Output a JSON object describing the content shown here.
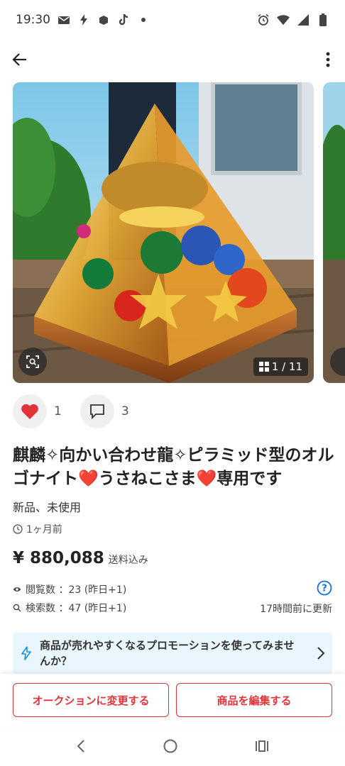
{
  "status_bar": {
    "time": "19:30",
    "left_icons": [
      "mail-icon",
      "bolt-icon",
      "app-icon",
      "tiktok-icon",
      "dot-icon"
    ],
    "right_icons": [
      "alarm-icon",
      "wifi-icon",
      "signal-icon",
      "battery-icon"
    ]
  },
  "gallery": {
    "page_indicator": "1 / 11"
  },
  "actions": {
    "like_count": "1",
    "comment_count": "3"
  },
  "item": {
    "title": "麒麟✧向かい合わせ龍✧ピラミッド型のオルゴナイト❤️うさねこさま❤️専用です",
    "condition": "新品、未使用",
    "posted": "1ヶ月前",
    "price": "¥ 880,088",
    "shipping": "送料込み"
  },
  "stats": {
    "views_label": "閲覧数 ：23 (昨日+1)",
    "searches_label": "検索数 ：47 (昨日+1)",
    "updated": "17時間前に更新"
  },
  "promo": {
    "text": "商品が売れやすくなるプロモーションを使ってみませんか？"
  },
  "buttons": {
    "auction": "オークションに変更する",
    "edit": "商品を編集する"
  },
  "colors": {
    "accent": "#e0343a",
    "promo_bg": "#eaf6fd",
    "help_blue": "#1a6fd6"
  }
}
